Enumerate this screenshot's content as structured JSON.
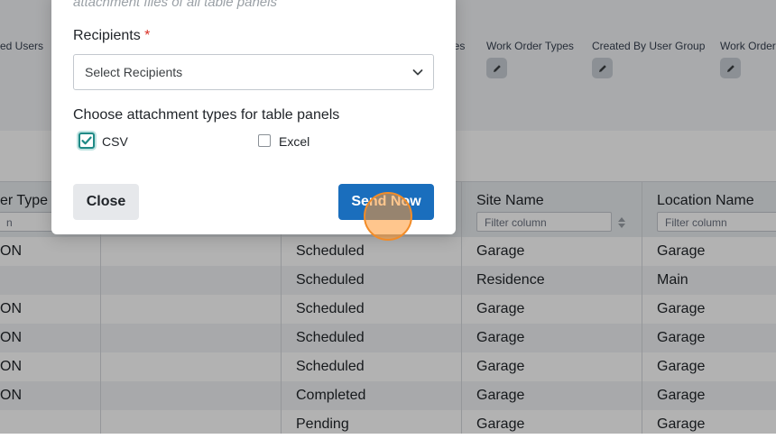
{
  "background": {
    "filter_columns": [
      {
        "label": "ed Users",
        "has_edit": false
      },
      {
        "label": "ies",
        "has_edit": false
      },
      {
        "label": "Work Order Types",
        "has_edit": true
      },
      {
        "label": "Created By User Group",
        "has_edit": true
      },
      {
        "label": "Work Order",
        "has_edit": true
      }
    ],
    "table": {
      "headers": [
        {
          "label": "er Type",
          "filter": "n"
        },
        {
          "label": "",
          "filter": ""
        },
        {
          "label": "",
          "filter": ""
        },
        {
          "label": "Site Name",
          "filter": "Filter column"
        },
        {
          "label": "Location Name",
          "filter": "Filter column"
        }
      ],
      "rows": [
        [
          "ON",
          "",
          "Scheduled",
          "Garage",
          "Garage"
        ],
        [
          "",
          "",
          "Scheduled",
          "Residence",
          "Main"
        ],
        [
          "ON",
          "",
          "Scheduled",
          "Garage",
          "Garage"
        ],
        [
          "ON",
          "",
          "Scheduled",
          "Garage",
          "Garage"
        ],
        [
          "ON",
          "",
          "Scheduled",
          "Garage",
          "Garage"
        ],
        [
          "ON",
          "",
          "Completed",
          "Garage",
          "Garage"
        ],
        [
          "",
          "",
          "Pending",
          "Garage",
          "Garage"
        ]
      ]
    }
  },
  "modal": {
    "subtitle": "attachment files of all table panels",
    "recipients_label": "Recipients",
    "required_mark": "*",
    "recipients_placeholder": "Select Recipients",
    "attachment_label": "Choose attachment types for table panels",
    "options": [
      {
        "label": "CSV",
        "checked": true
      },
      {
        "label": "Excel",
        "checked": false
      }
    ],
    "close_label": "Close",
    "send_label": "Send Now"
  },
  "colors": {
    "primary": "#1a6ebd",
    "checkbox_accent": "#1f8a86",
    "required": "#d93025",
    "cursor": "#f28c28"
  }
}
